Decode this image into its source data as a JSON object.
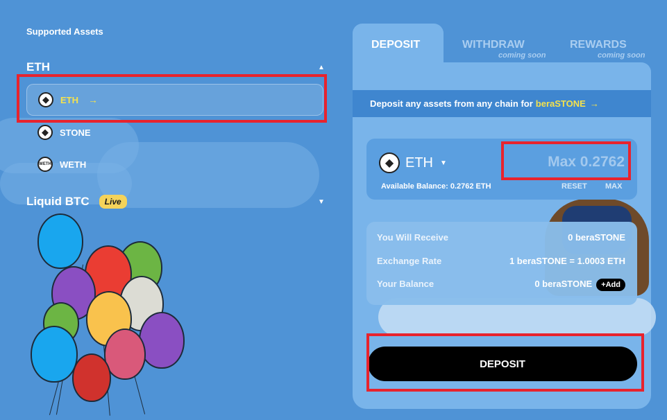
{
  "sidebar": {
    "section_label": "Supported Assets",
    "groups": [
      {
        "title": "ETH",
        "items": [
          {
            "label": "ETH",
            "icon": "eth-icon"
          },
          {
            "label": "STONE",
            "icon": "stone-icon"
          },
          {
            "label": "WETH",
            "icon": "weth-icon"
          }
        ]
      },
      {
        "title": "Liquid BTC",
        "badge": "Live"
      }
    ]
  },
  "tabs": [
    {
      "label": "DEPOSIT",
      "note": ""
    },
    {
      "label": "WITHDRAW",
      "note": "coming soon"
    },
    {
      "label": "REWARDS",
      "note": "coming soon"
    }
  ],
  "banner": {
    "prefix": "Deposit any assets from any chain for",
    "highlight": "beraSTONE"
  },
  "input": {
    "token": "ETH",
    "amount_placeholder": "Max 0.2762",
    "available_label": "Available Balance:",
    "available_value": "0.2762 ETH",
    "reset_label": "RESET",
    "max_label": "MAX"
  },
  "info": {
    "receive": {
      "label": "You Will Receive",
      "value": "0 beraSTONE"
    },
    "rate": {
      "label": "Exchange Rate",
      "value": "1 beraSTONE = 1.0003 ETH"
    },
    "balance": {
      "label": "Your Balance",
      "value": "0 beraSTONE",
      "add_label": "+Add"
    }
  },
  "deposit_button": "DEPOSIT",
  "colors": {
    "background": "#4f93d6",
    "accent": "#f5e24c",
    "highlight_box": "#e8232d"
  }
}
